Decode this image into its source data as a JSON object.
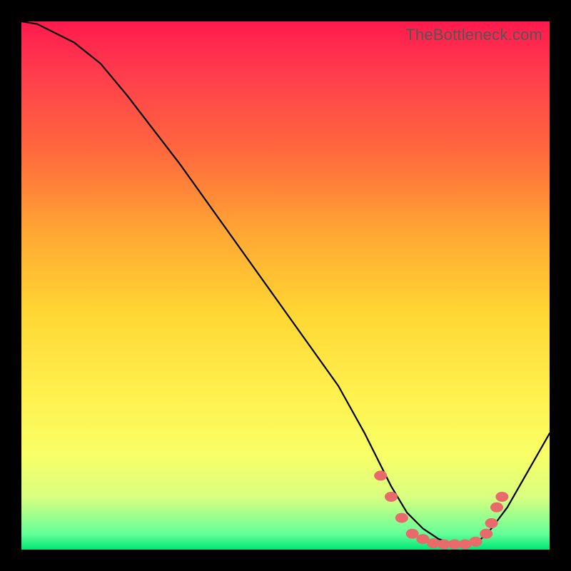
{
  "watermark": "TheBottleneck.com",
  "chart_data": {
    "type": "line",
    "title": "",
    "xlabel": "",
    "ylabel": "",
    "xlim": [
      0,
      100
    ],
    "ylim": [
      0,
      100
    ],
    "series": [
      {
        "name": "curve",
        "x": [
          0,
          3,
          10,
          15,
          20,
          30,
          40,
          50,
          60,
          65,
          68,
          70,
          73,
          76,
          79,
          82,
          85,
          87,
          89,
          92,
          100
        ],
        "y": [
          100,
          99.5,
          96,
          92,
          86,
          73,
          59,
          45,
          31,
          22,
          16,
          12,
          7,
          4,
          2,
          1,
          1,
          2,
          4,
          8,
          22
        ]
      }
    ],
    "markers": [
      {
        "x": 68,
        "y": 14
      },
      {
        "x": 70,
        "y": 10
      },
      {
        "x": 72,
        "y": 6
      },
      {
        "x": 74,
        "y": 3
      },
      {
        "x": 76,
        "y": 2
      },
      {
        "x": 78,
        "y": 1.2
      },
      {
        "x": 80,
        "y": 1
      },
      {
        "x": 82,
        "y": 1
      },
      {
        "x": 84,
        "y": 1
      },
      {
        "x": 86,
        "y": 1.5
      },
      {
        "x": 88,
        "y": 3
      },
      {
        "x": 89,
        "y": 5
      },
      {
        "x": 90,
        "y": 8
      },
      {
        "x": 91,
        "y": 10
      }
    ],
    "gradient_note": "Background is a vertical heat gradient from red (top / high y) to green (bottom / low y) implying lower values are better."
  }
}
